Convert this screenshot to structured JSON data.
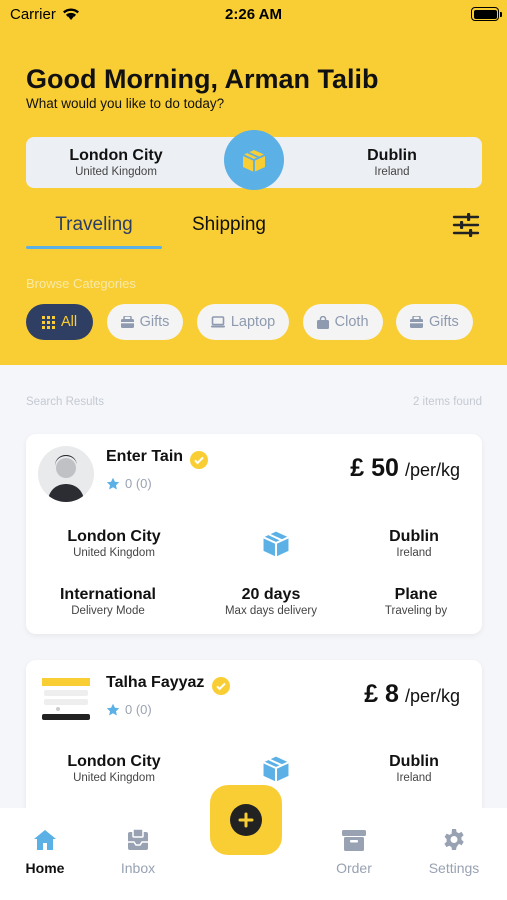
{
  "status": {
    "carrier": "Carrier",
    "time": "2:26 AM"
  },
  "header": {
    "greeting": "Good Morning, Arman Talib",
    "subtitle": "What would you like to do today?"
  },
  "route": {
    "from_city": "London City",
    "from_country": "United Kingdom",
    "to_city": "Dublin",
    "to_country": "Ireland"
  },
  "tabs": {
    "traveling": "Traveling",
    "shipping": "Shipping"
  },
  "browse_label": "Browse Categories",
  "categories": [
    {
      "label": "All"
    },
    {
      "label": "Gifts"
    },
    {
      "label": "Laptop"
    },
    {
      "label": "Cloth"
    },
    {
      "label": "Gifts"
    }
  ],
  "results": {
    "label": "Search Results",
    "count": "2 items found"
  },
  "cards": [
    {
      "name": "Enter Tain",
      "rating": "0 (0)",
      "price": "£ 50",
      "unit": "/per/kg",
      "from_city": "London City",
      "from_country": "United Kingdom",
      "to_city": "Dublin",
      "to_country": "Ireland",
      "mode": "International",
      "mode_label": "Delivery Mode",
      "days": "20 days",
      "days_label": "Max days delivery",
      "vehicle": "Plane",
      "vehicle_label": "Traveling by"
    },
    {
      "name": "Talha Fayyaz",
      "rating": "0 (0)",
      "price": "£ 8",
      "unit": "/per/kg",
      "from_city": "London City",
      "from_country": "United Kingdom",
      "to_city": "Dublin",
      "to_country": "Ireland"
    }
  ],
  "nav": {
    "home": "Home",
    "inbox": "Inbox",
    "order": "Order",
    "settings": "Settings"
  },
  "colors": {
    "accent": "#f9ce35",
    "navy": "#2f3f63",
    "blue": "#5bb0e6"
  }
}
